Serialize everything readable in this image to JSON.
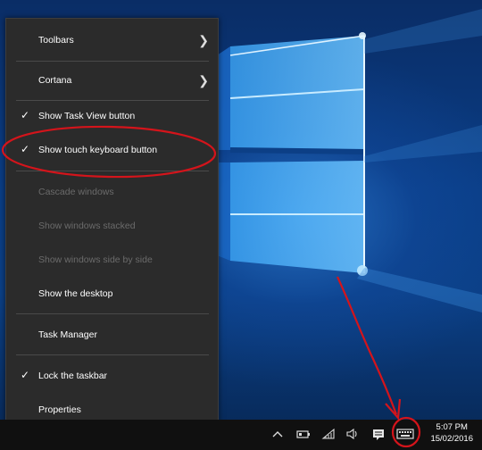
{
  "menu": {
    "items": [
      {
        "label": "Toolbars",
        "submenu": true,
        "checked": false,
        "disabled": false
      },
      {
        "label": "Cortana",
        "submenu": true,
        "checked": false,
        "disabled": false
      },
      {
        "label": "Show Task View button",
        "checked": true,
        "disabled": false
      },
      {
        "label": "Show touch keyboard button",
        "checked": true,
        "disabled": false
      },
      {
        "label": "Cascade windows",
        "checked": false,
        "disabled": true
      },
      {
        "label": "Show windows stacked",
        "checked": false,
        "disabled": true
      },
      {
        "label": "Show windows side by side",
        "checked": false,
        "disabled": true
      },
      {
        "label": "Show the desktop",
        "checked": false,
        "disabled": false
      },
      {
        "label": "Task Manager",
        "checked": false,
        "disabled": false
      },
      {
        "label": "Lock the taskbar",
        "checked": true,
        "disabled": false
      },
      {
        "label": "Properties",
        "checked": false,
        "disabled": false
      }
    ]
  },
  "icons": {
    "submenu_arrow": "chevron-right-icon",
    "check": "checkmark-icon"
  },
  "taskbar": {
    "time": "5:07 PM",
    "date": "15/02/2016",
    "tray_icons": [
      "chevron-up-icon",
      "battery-icon",
      "network-icon",
      "volume-icon",
      "action-center-icon",
      "touch-keyboard-icon"
    ]
  },
  "colors": {
    "menu_bg": "#2b2b2b",
    "annotation": "#d4141b",
    "taskbar_bg": "#101010"
  }
}
